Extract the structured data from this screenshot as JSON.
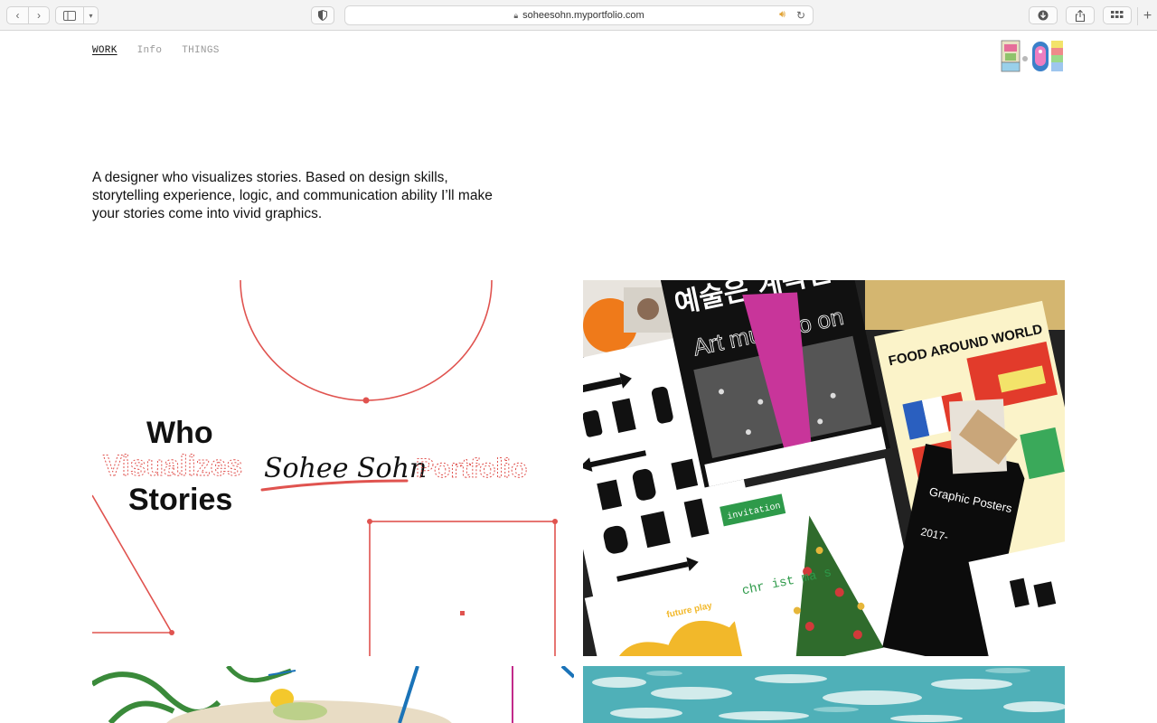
{
  "browser": {
    "url": "soheesohn.myportfolio.com",
    "icons": [
      "back-icon",
      "forward-icon",
      "sidebar-icon",
      "chevron-down-icon",
      "shield-icon",
      "lock-icon",
      "sound-icon",
      "reload-icon",
      "download-icon",
      "share-icon",
      "tabs-overview-icon",
      "new-tab-icon"
    ]
  },
  "nav": {
    "items": [
      "WORK",
      "Info",
      "THINGS"
    ],
    "active": "WORK"
  },
  "intro": {
    "text": "A designer who visualizes stories. Based on design skills, storytelling experience, logic, and communication ability I’ll make your stories come into vivid graphics."
  },
  "projects": {
    "portfolio": {
      "word1": "Who",
      "word2": "Visualizes",
      "signature": "Sohee Sohn",
      "word3": "Portfolio",
      "word4": "Stories"
    },
    "posters": {
      "label_title": "Graphic Posters",
      "label_year": "2017-",
      "poster_headline_ko": "예술은 계속된다",
      "poster_headline_en": "Art must go on",
      "food_poster": "FOOD AROUND WORLD",
      "invitation": "invitation",
      "futureplay": "future play",
      "christmas": "chr ist ma s"
    }
  },
  "colors": {
    "accent_red": "#e0534f",
    "ocean": "#5fb7bf",
    "black": "#111111"
  }
}
